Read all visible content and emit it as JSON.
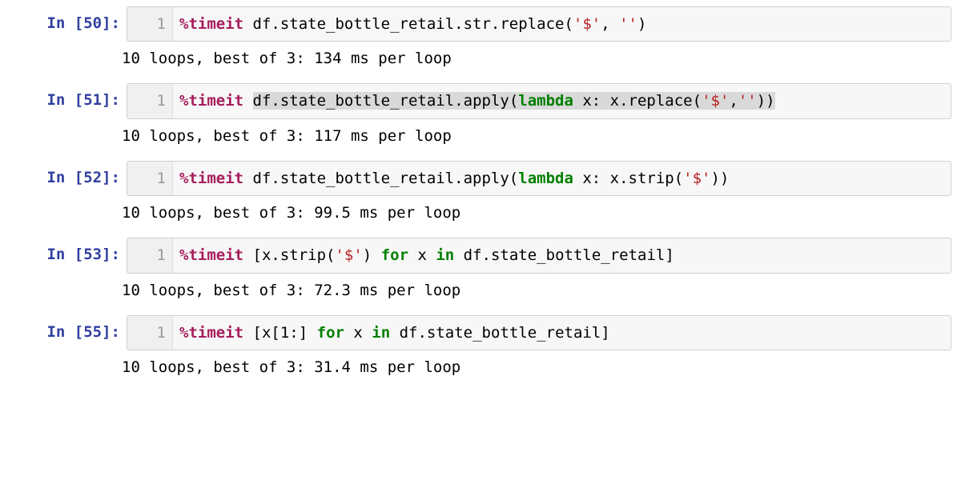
{
  "cells": [
    {
      "exec_count": 50,
      "prompt": "In [50]:",
      "line_no": "1",
      "selection": false,
      "tokens": [
        {
          "cls": "mag",
          "t": "%timeit"
        },
        {
          "cls": "txt",
          "t": " df.state_bottle_retail.str.replace("
        },
        {
          "cls": "str",
          "t": "'$'"
        },
        {
          "cls": "txt",
          "t": ", "
        },
        {
          "cls": "str",
          "t": "''"
        },
        {
          "cls": "txt",
          "t": ")"
        }
      ],
      "output": "10 loops, best of 3: 134 ms per loop"
    },
    {
      "exec_count": 51,
      "prompt": "In [51]:",
      "line_no": "1",
      "selection": true,
      "tokens_pre": [
        {
          "cls": "mag",
          "t": "%timeit"
        },
        {
          "cls": "txt",
          "t": " "
        }
      ],
      "tokens_sel": [
        {
          "cls": "txt",
          "t": "df.state_bottle_retail.apply("
        },
        {
          "cls": "kw",
          "t": "lambda"
        },
        {
          "cls": "txt",
          "t": " x: x.replace("
        },
        {
          "cls": "str",
          "t": "'$'"
        },
        {
          "cls": "txt",
          "t": ","
        },
        {
          "cls": "str",
          "t": "''"
        },
        {
          "cls": "txt",
          "t": "))"
        }
      ],
      "output": "10 loops, best of 3: 117 ms per loop"
    },
    {
      "exec_count": 52,
      "prompt": "In [52]:",
      "line_no": "1",
      "selection": false,
      "tokens": [
        {
          "cls": "mag",
          "t": "%timeit"
        },
        {
          "cls": "txt",
          "t": " df.state_bottle_retail.apply("
        },
        {
          "cls": "kw",
          "t": "lambda"
        },
        {
          "cls": "txt",
          "t": " x: x.strip("
        },
        {
          "cls": "str",
          "t": "'$'"
        },
        {
          "cls": "txt",
          "t": "))"
        }
      ],
      "output": "10 loops, best of 3: 99.5 ms per loop"
    },
    {
      "exec_count": 53,
      "prompt": "In [53]:",
      "line_no": "1",
      "selection": false,
      "tokens": [
        {
          "cls": "mag",
          "t": "%timeit"
        },
        {
          "cls": "txt",
          "t": " [x.strip("
        },
        {
          "cls": "str",
          "t": "'$'"
        },
        {
          "cls": "txt",
          "t": ") "
        },
        {
          "cls": "kw",
          "t": "for"
        },
        {
          "cls": "txt",
          "t": " x "
        },
        {
          "cls": "kw",
          "t": "in"
        },
        {
          "cls": "txt",
          "t": " df.state_bottle_retail]"
        }
      ],
      "output": "10 loops, best of 3: 72.3 ms per loop"
    },
    {
      "exec_count": 55,
      "prompt": "In [55]:",
      "line_no": "1",
      "selection": false,
      "tokens": [
        {
          "cls": "mag",
          "t": "%timeit"
        },
        {
          "cls": "txt",
          "t": " [x["
        },
        {
          "cls": "txt",
          "t": "1"
        },
        {
          "cls": "txt",
          "t": ":] "
        },
        {
          "cls": "kw",
          "t": "for"
        },
        {
          "cls": "txt",
          "t": " x "
        },
        {
          "cls": "kw",
          "t": "in"
        },
        {
          "cls": "txt",
          "t": " df.state_bottle_retail]"
        }
      ],
      "output": "10 loops, best of 3: 31.4 ms per loop"
    }
  ]
}
